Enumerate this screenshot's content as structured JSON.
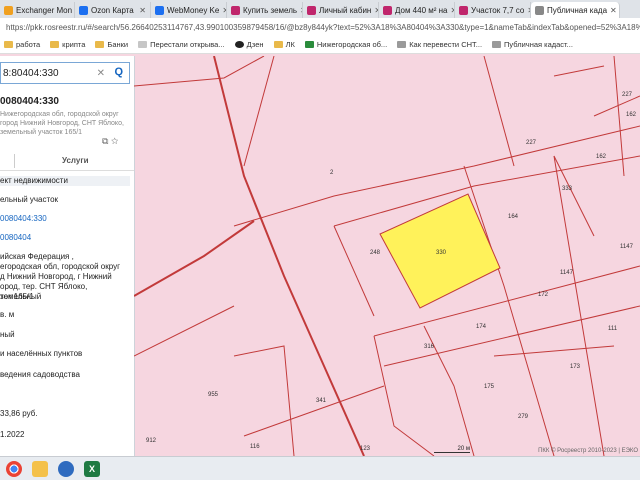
{
  "browser": {
    "tabs": [
      {
        "label": "Exchanger Mon",
        "color": "#f0a020"
      },
      {
        "label": "Ozon Карта",
        "color": "#1c6ff0"
      },
      {
        "label": "WebMoney Ke",
        "color": "#1c6ff0"
      },
      {
        "label": "Купить земель",
        "color": "#c0266c"
      },
      {
        "label": "Личный кабин",
        "color": "#c0266c"
      },
      {
        "label": "Дом 440 м² на",
        "color": "#c0266c"
      },
      {
        "label": "Участок 7,7 со",
        "color": "#c0266c"
      },
      {
        "label": "Публичная када",
        "color": "#888888"
      }
    ],
    "url": "https://pkk.rosreestr.ru/#/search/56.26640253114767,43.990100359879458/16/@bz8y844yk?text=52%3A18%3A80404%3A330&type=1&nameTab&indexTab&opened=52%3A18%3A80",
    "bookmarks": [
      "работа",
      "крипта",
      "Банки",
      "Перестали открыва...",
      "Дзен",
      "ЛК",
      "Нижегородская об...",
      "Как перевести СНТ...",
      "Публичная кадаст..."
    ]
  },
  "panel": {
    "search_value": "8:80404:330",
    "clear_glyph": "✕",
    "search_glyph": "Q",
    "object_number": "0080404:330",
    "object_address": "Нижегородская обл, городской округ город Нижний Новгород, СНТ Яблоко, земельный участок 165/1",
    "tab_services": "Услуги",
    "fields": [
      "ект недвижимости",
      "ельный участок",
      "0080404:330",
      "0080404",
      "ийская Федерация ,",
      "егородская обл, городской округ",
      "д Нижний Новгород, г Нижний",
      "ород, тер. СНТ Яблоко, земельный",
      "ток 165/1",
      "в. м",
      "ный",
      "и населённых пунктов",
      "ведения садоводства",
      "33,86 руб.",
      "1.2022"
    ]
  },
  "map": {
    "highlight_color": "#fff25a",
    "parcel_labels": [
      "2",
      "330",
      "164",
      "333",
      "162",
      "227",
      "1147",
      "248",
      "172",
      "174",
      "316",
      "175",
      "173",
      "279",
      "955",
      "341",
      "912",
      "116",
      "123",
      "227",
      "162",
      "1147",
      "111"
    ],
    "scale": "20 м",
    "copyright": "ПКК © Росреестр 2010-2023 | ЕЭКО"
  }
}
